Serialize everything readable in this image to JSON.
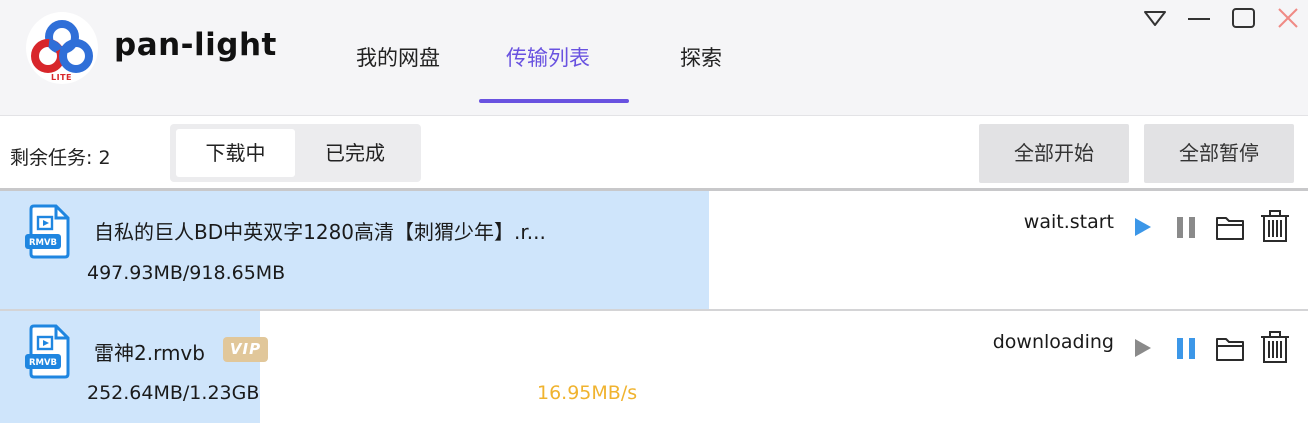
{
  "app": {
    "name": "pan-light",
    "logo_tag": "LITE"
  },
  "nav": {
    "tabs": [
      {
        "label": "我的网盘",
        "active": false
      },
      {
        "label": "传输列表",
        "active": true
      },
      {
        "label": "探索",
        "active": false
      }
    ]
  },
  "window_controls": [
    "dropdown-icon",
    "minimize-icon",
    "maximize-icon",
    "close-icon"
  ],
  "toolbar": {
    "remaining_tasks": "剩余任务: 2",
    "segments": [
      {
        "label": "下载中",
        "active": true
      },
      {
        "label": "已完成",
        "active": false
      }
    ],
    "start_all": "全部开始",
    "pause_all": "全部暂停"
  },
  "tasks": [
    {
      "name": "自私的巨人BD中英双字1280高清【刺猬少年】.r...",
      "size_progress": "497.93MB/918.65MB",
      "progress_fraction": 0.542,
      "status": "wait.start",
      "speed": "",
      "vip": false,
      "file_type": "RMVB",
      "active_control": "play"
    },
    {
      "name": "雷神2.rmvb",
      "size_progress": "252.64MB/1.23GB",
      "progress_fraction": 0.199,
      "status": "downloading",
      "speed": "16.95MB/s",
      "vip": true,
      "vip_label": "VIP",
      "file_type": "RMVB",
      "active_control": "pause"
    }
  ],
  "colors": {
    "accent": "#6952e0",
    "progress_fill": "#cfe5fb",
    "control_active": "#3c97e8",
    "control_inactive": "#8a8a8a",
    "speed": "#f0b32f",
    "vip_badge": "#e1c79a",
    "file_icon": "#1f86e0",
    "close_icon": "#f08a85"
  }
}
